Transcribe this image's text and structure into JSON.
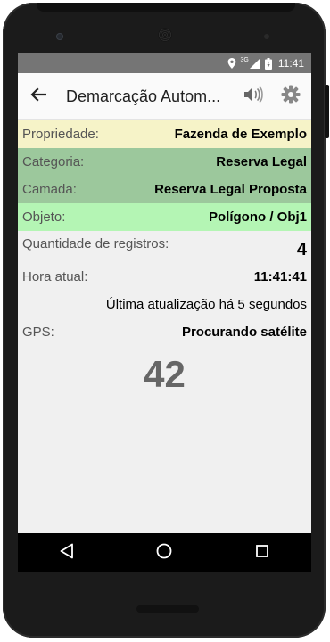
{
  "status_bar": {
    "time": "11:41",
    "network_type": "3G",
    "icons": [
      "location-icon",
      "signal-icon",
      "battery-icon"
    ]
  },
  "app_bar": {
    "title": "Demarcação Autom...",
    "icons": [
      "back-arrow-icon",
      "speaker-icon",
      "gear-icon"
    ]
  },
  "info": {
    "propriedade": {
      "label": "Propriedade:",
      "value": "Fazenda de Exemplo"
    },
    "categoria": {
      "label": "Categoria:",
      "value": "Reserva Legal"
    },
    "camada": {
      "label": "Camada:",
      "value": "Reserva Legal Proposta"
    },
    "objeto": {
      "label": "Objeto:",
      "value": "Polígono / Obj1"
    },
    "quantidade": {
      "label": "Quantidade de registros:",
      "value": "4"
    },
    "hora": {
      "label": "Hora atual:",
      "value": "11:41:41"
    },
    "ultima_atualizacao": "Última atualização há 5 segundos",
    "gps": {
      "label": "GPS:",
      "value": "Procurando satélite"
    },
    "big_number": "42"
  },
  "colors": {
    "propriedade_bg": "#f6f3c8",
    "categoria_bg": "#9cc89c",
    "camada_bg": "#9cc89c",
    "objeto_bg": "#b4f5b4",
    "status_bar_bg": "#757575"
  },
  "nav_bar": {
    "icons": [
      "back-triangle-icon",
      "home-circle-icon",
      "recents-square-icon"
    ]
  }
}
